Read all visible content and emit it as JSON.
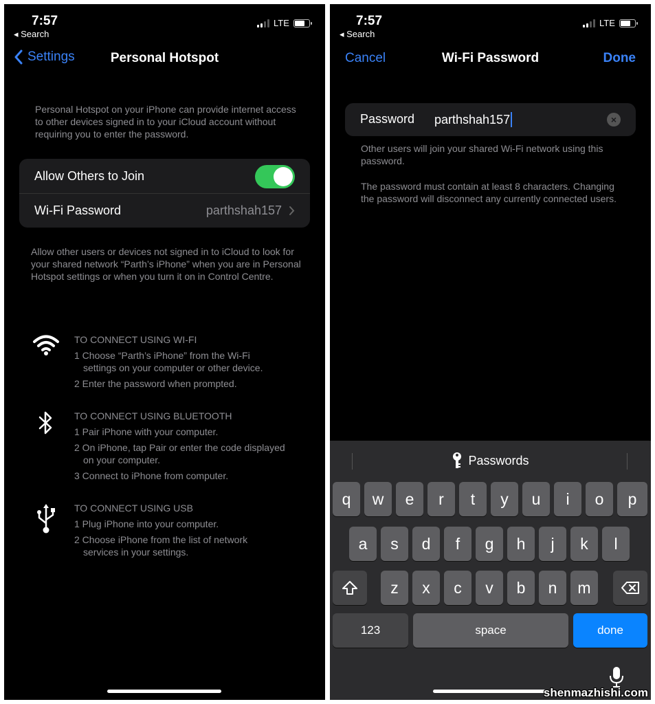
{
  "left": {
    "status": {
      "time": "7:57",
      "back": "◂ Search",
      "carrier": "LTE"
    },
    "nav": {
      "back_label": "Settings",
      "title": "Personal Hotspot"
    },
    "intro": "Personal Hotspot on your iPhone can provide internet access to other devices signed in to your iCloud account without requiring you to enter the password.",
    "rows": {
      "allow_label": "Allow Others to Join",
      "allow_on": true,
      "wifi_label": "Wi-Fi Password",
      "wifi_value": "parthshah157"
    },
    "allow_desc": "Allow other users or devices not signed in to iCloud to look for your shared network “Parth’s iPhone” when you are in Personal Hotspot settings or when you turn it on in Control Centre.",
    "wifi_section": {
      "icon": "wifi-icon",
      "heading": "TO CONNECT USING WI-FI",
      "steps": [
        "1 Choose “Parth’s iPhone” from the Wi-Fi",
        "settings on your computer or other device.",
        "2 Enter the password when prompted."
      ]
    },
    "bt_section": {
      "icon": "bluetooth-icon",
      "heading": "TO CONNECT USING BLUETOOTH",
      "steps": [
        "1 Pair iPhone with your computer.",
        "2 On iPhone, tap Pair or enter the code displayed",
        "on your computer.",
        "3 Connect to iPhone from computer."
      ]
    },
    "usb_section": {
      "icon": "usb-icon",
      "heading": "TO CONNECT USING USB",
      "steps": [
        "1 Plug iPhone into your computer.",
        "2 Choose iPhone from the list of network",
        "services in your settings."
      ]
    }
  },
  "right": {
    "status": {
      "time": "7:57",
      "back": "◂ Search",
      "carrier": "LTE"
    },
    "nav": {
      "cancel": "Cancel",
      "title": "Wi-Fi Password",
      "done": "Done"
    },
    "field": {
      "label": "Password",
      "value": "parthshah157"
    },
    "note1": "Other users will join your shared Wi-Fi network using this password.",
    "note2": "The password must contain at least 8 characters. Changing the password will disconnect any currently connected users.",
    "keyboard": {
      "suggestion": "Passwords",
      "row1": [
        "q",
        "w",
        "e",
        "r",
        "t",
        "y",
        "u",
        "i",
        "o",
        "p"
      ],
      "row2": [
        "a",
        "s",
        "d",
        "f",
        "g",
        "h",
        "j",
        "k",
        "l"
      ],
      "row3": [
        "z",
        "x",
        "c",
        "v",
        "b",
        "n",
        "m"
      ],
      "numbers_key": "123",
      "space_key": "space",
      "done_key": "done"
    }
  },
  "watermark": "shenmazhishi.com",
  "colors": {
    "accent": "#3a82f7",
    "toggle_on": "#34c759",
    "done_key": "#0a84ff"
  }
}
